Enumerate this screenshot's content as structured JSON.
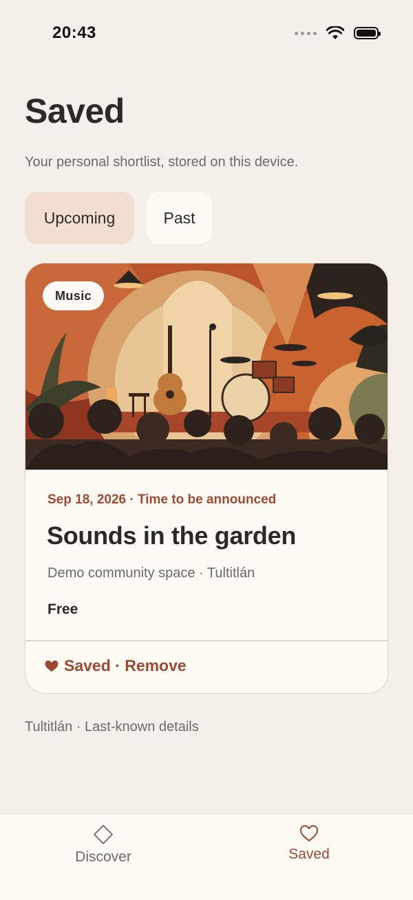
{
  "status_bar": {
    "time": "20:43"
  },
  "header": {
    "title": "Saved",
    "subtitle": "Your personal shortlist, stored on this device."
  },
  "filter_tabs": [
    {
      "label": "Upcoming",
      "selected": true
    },
    {
      "label": "Past",
      "selected": false
    }
  ],
  "saved_events": [
    {
      "category": "Music",
      "date_time": "Sep 18, 2026 · Time to be announced",
      "title": "Sounds in the garden",
      "venue_city": "Demo community space · Tultitlán",
      "price": "Free",
      "action_label": "Saved · Remove"
    }
  ],
  "footer_note": "Tultitlán · Last-known details",
  "bottom_nav": [
    {
      "label": "Discover",
      "icon": "diamond-icon",
      "active": false
    },
    {
      "label": "Saved",
      "icon": "heart-icon",
      "active": true
    }
  ],
  "colors": {
    "accent": "#9b4a34",
    "background": "#f4f0e9",
    "card": "#fdfaf3",
    "active_tab": "#f1ddd1"
  }
}
